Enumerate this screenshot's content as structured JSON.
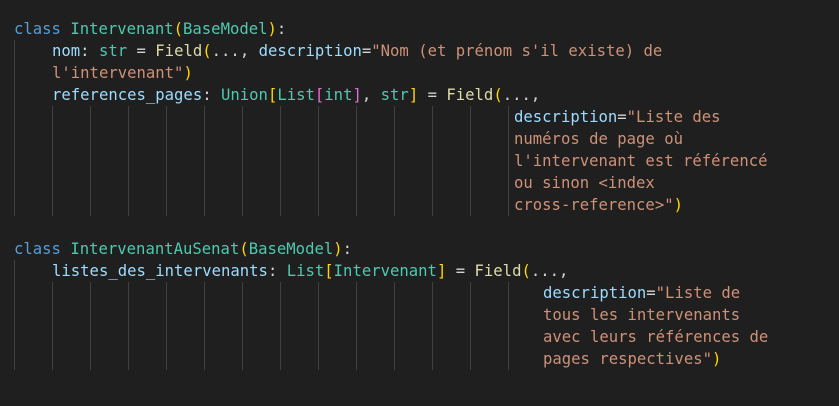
{
  "editor": {
    "background": "#1f1f1f",
    "token_colors": {
      "keyword": "#569cd6",
      "class": "#4ec9b0",
      "variable": "#9cdcfe",
      "function": "#dcdcaa",
      "string": "#ce9178",
      "bracket_1": "#ffd700",
      "bracket_2": "#da70d6",
      "bracket_3": "#179fff"
    },
    "code": {
      "class1": {
        "kw": "class",
        "name": "Intervenant",
        "base": "BaseModel",
        "field1": {
          "name": "nom",
          "type": "str",
          "func": "Field",
          "ellipsis": "...",
          "param": "description",
          "str_l1": "\"Nom (et prénom s'il existe) de",
          "str_l2": "l'intervenant\""
        },
        "field2": {
          "name": "references_pages",
          "t1": "Union",
          "t2": "List",
          "t3": "int",
          "t4": "str",
          "func": "Field",
          "ellipsis": "...",
          "param": "description",
          "str_l1": "\"Liste des",
          "str_l2": "numéros de page où",
          "str_l3": "l'intervenant est référencé",
          "str_l4": "ou sinon <index",
          "str_l5": "cross-reference>\""
        }
      },
      "class2": {
        "kw": "class",
        "name": "IntervenantAuSenat",
        "base": "BaseModel",
        "field1": {
          "name": "listes_des_intervenants",
          "t1": "List",
          "t2": "Intervenant",
          "func": "Field",
          "ellipsis": "...",
          "param": "description",
          "str_l1": "\"Liste de",
          "str_l2": "tous les intervenants",
          "str_l3": "avec leurs références de",
          "str_l4": "pages respectives\""
        }
      }
    }
  }
}
